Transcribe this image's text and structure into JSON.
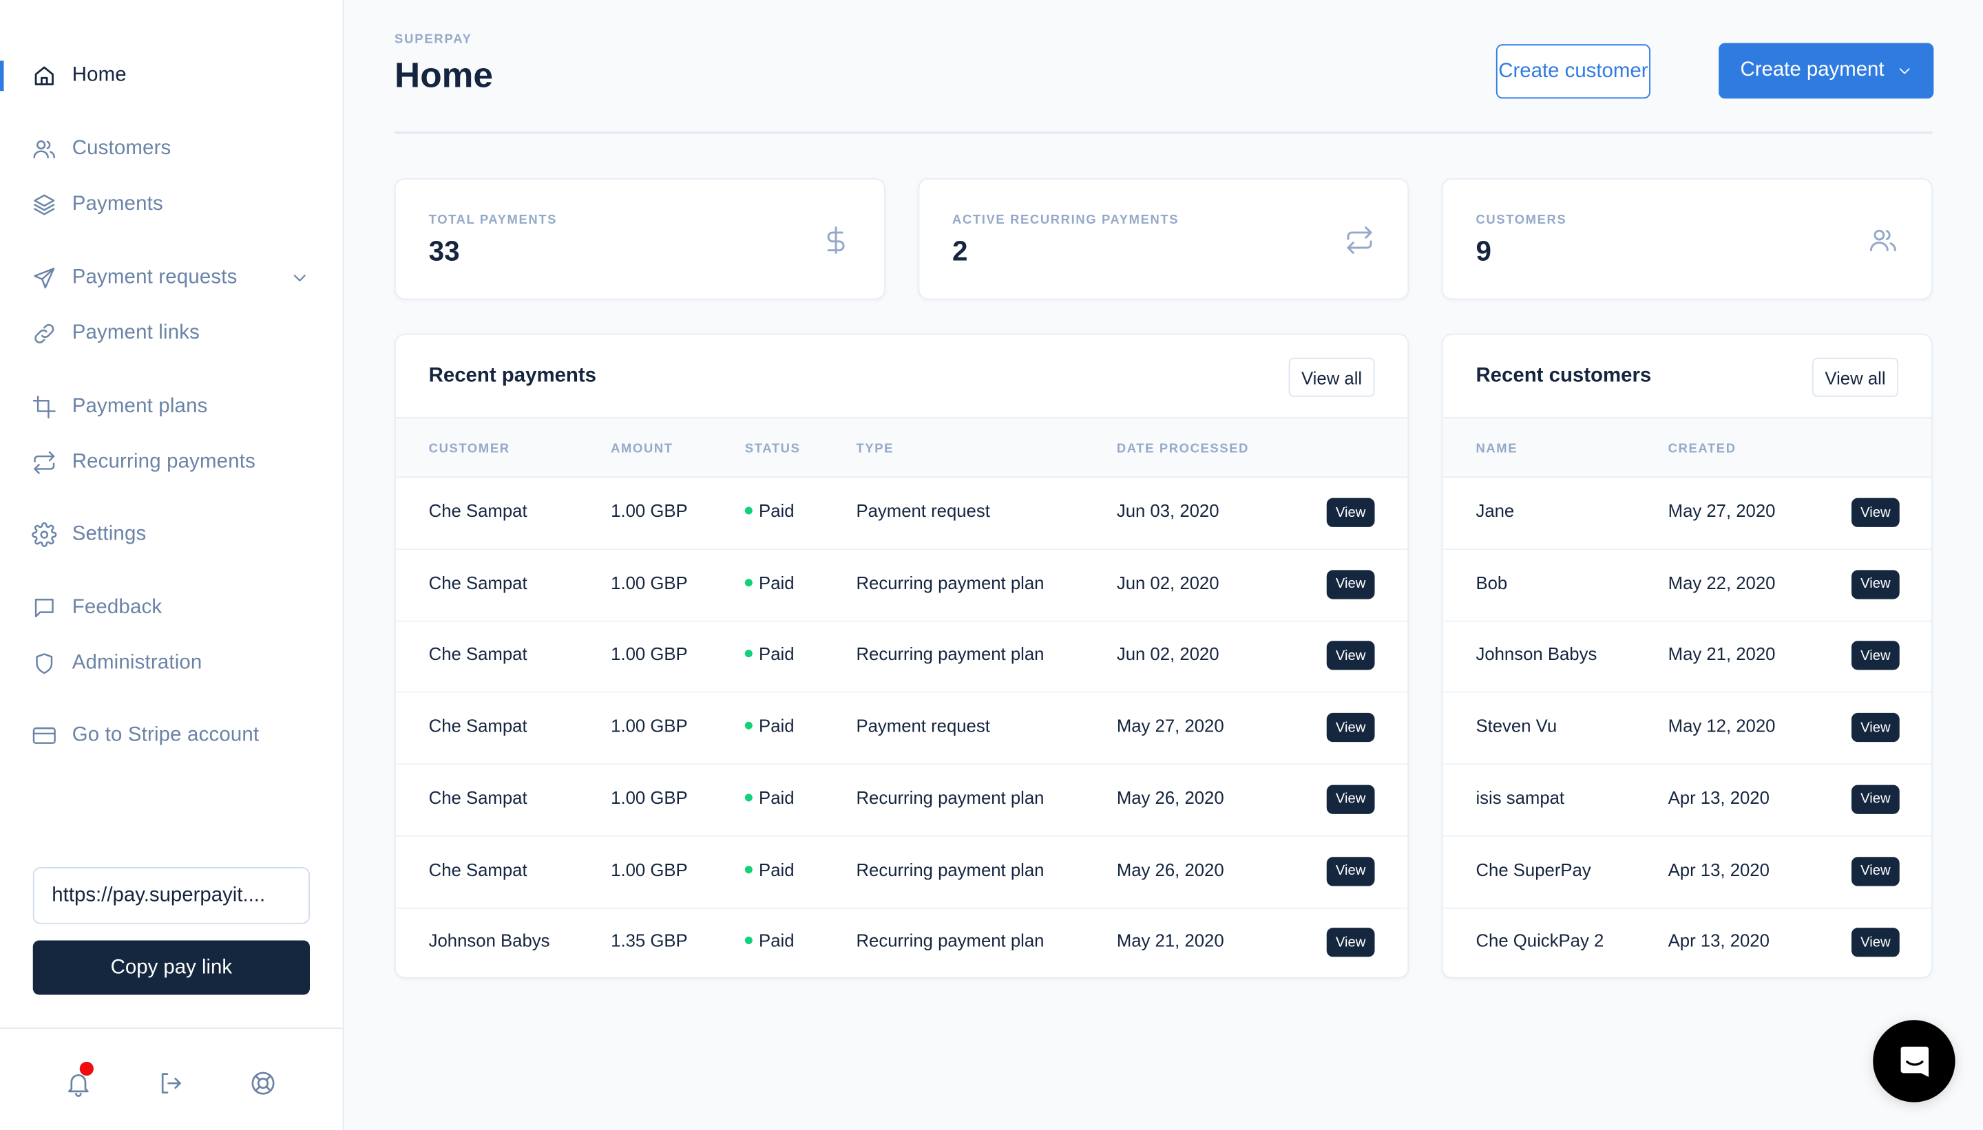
{
  "sidebar": {
    "nav": [
      {
        "label": "Home",
        "icon": "home-icon",
        "active": true
      },
      {
        "label": "Customers",
        "icon": "users-icon"
      },
      {
        "label": "Payments",
        "icon": "layers-icon"
      },
      {
        "label": "Payment requests",
        "icon": "send-icon",
        "has_submenu": true
      },
      {
        "label": "Payment links",
        "icon": "link-icon"
      },
      {
        "label": "Payment plans",
        "icon": "crop-icon"
      },
      {
        "label": "Recurring payments",
        "icon": "repeat-icon"
      },
      {
        "label": "Settings",
        "icon": "gear-icon"
      },
      {
        "label": "Feedback",
        "icon": "message-square-icon"
      },
      {
        "label": "Administration",
        "icon": "shield-icon"
      },
      {
        "label": "Go to Stripe account",
        "icon": "credit-card-icon"
      }
    ],
    "pay_link_value": "https://pay.superpayit....",
    "copy_button_label": "Copy pay link",
    "footer_icons": [
      "bell-icon",
      "logout-icon",
      "lifebuoy-icon"
    ],
    "notification_indicator_color": "#f20c0c"
  },
  "header": {
    "eyebrow": "SUPERPAY",
    "title": "Home",
    "create_customer_label": "Create customer",
    "create_payment_label": "Create payment"
  },
  "stats": [
    {
      "label": "TOTAL PAYMENTS",
      "value": "33",
      "icon": "dollar-icon"
    },
    {
      "label": "ACTIVE RECURRING PAYMENTS",
      "value": "2",
      "icon": "repeat-icon"
    },
    {
      "label": "CUSTOMERS",
      "value": "9",
      "icon": "users-icon"
    }
  ],
  "recent_payments": {
    "title": "Recent payments",
    "view_all_label": "View all",
    "columns": [
      "CUSTOMER",
      "AMOUNT",
      "STATUS",
      "TYPE",
      "DATE PROCESSED"
    ],
    "row_action_label": "View",
    "rows": [
      {
        "customer": "Che Sampat",
        "amount": "1.00 GBP",
        "status": "Paid",
        "type": "Payment request",
        "date": "Jun 03, 2020"
      },
      {
        "customer": "Che Sampat",
        "amount": "1.00 GBP",
        "status": "Paid",
        "type": "Recurring payment plan",
        "date": "Jun 02, 2020"
      },
      {
        "customer": "Che Sampat",
        "amount": "1.00 GBP",
        "status": "Paid",
        "type": "Recurring payment plan",
        "date": "Jun 02, 2020"
      },
      {
        "customer": "Che Sampat",
        "amount": "1.00 GBP",
        "status": "Paid",
        "type": "Payment request",
        "date": "May 27, 2020"
      },
      {
        "customer": "Che Sampat",
        "amount": "1.00 GBP",
        "status": "Paid",
        "type": "Recurring payment plan",
        "date": "May 26, 2020"
      },
      {
        "customer": "Che Sampat",
        "amount": "1.00 GBP",
        "status": "Paid",
        "type": "Recurring payment plan",
        "date": "May 26, 2020"
      },
      {
        "customer": "Johnson Babys",
        "amount": "1.35 GBP",
        "status": "Paid",
        "type": "Recurring payment plan",
        "date": "May 21, 2020"
      }
    ]
  },
  "recent_customers": {
    "title": "Recent customers",
    "view_all_label": "View all",
    "columns": [
      "NAME",
      "CREATED"
    ],
    "row_action_label": "View",
    "rows": [
      {
        "name": "Jane",
        "created": "May 27, 2020"
      },
      {
        "name": "Bob",
        "created": "May 22, 2020"
      },
      {
        "name": "Johnson Babys",
        "created": "May 21, 2020"
      },
      {
        "name": "Steven Vu",
        "created": "May 12, 2020"
      },
      {
        "name": "isis sampat",
        "created": "Apr 13, 2020"
      },
      {
        "name": "Che SuperPay",
        "created": "Apr 13, 2020"
      },
      {
        "name": "Che QuickPay 2",
        "created": "Apr 13, 2020"
      }
    ]
  },
  "colors": {
    "accent": "#2f7be0",
    "dark": "#15273f",
    "muted": "#94a9c8",
    "status_paid": "#0fd27a"
  },
  "chat_launcher_icon": "chat-icon"
}
